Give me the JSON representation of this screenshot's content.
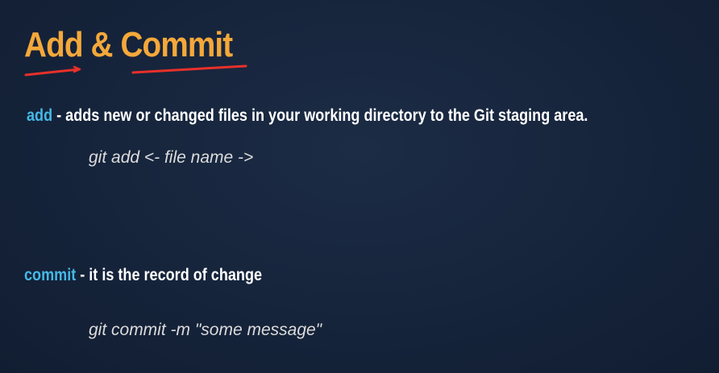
{
  "slide": {
    "title": "Add & Commit",
    "accent_color": "#f5a83a",
    "underline_color": "#e8302a",
    "keyword_color": "#45b8e6"
  },
  "items": [
    {
      "keyword": "add",
      "description": " - adds new or changed files in your working directory to the Git staging area.",
      "command": "git add <- file name ->"
    },
    {
      "keyword": "commit",
      "description": " - it is the record of change",
      "command": "git commit -m \"some message\""
    }
  ]
}
